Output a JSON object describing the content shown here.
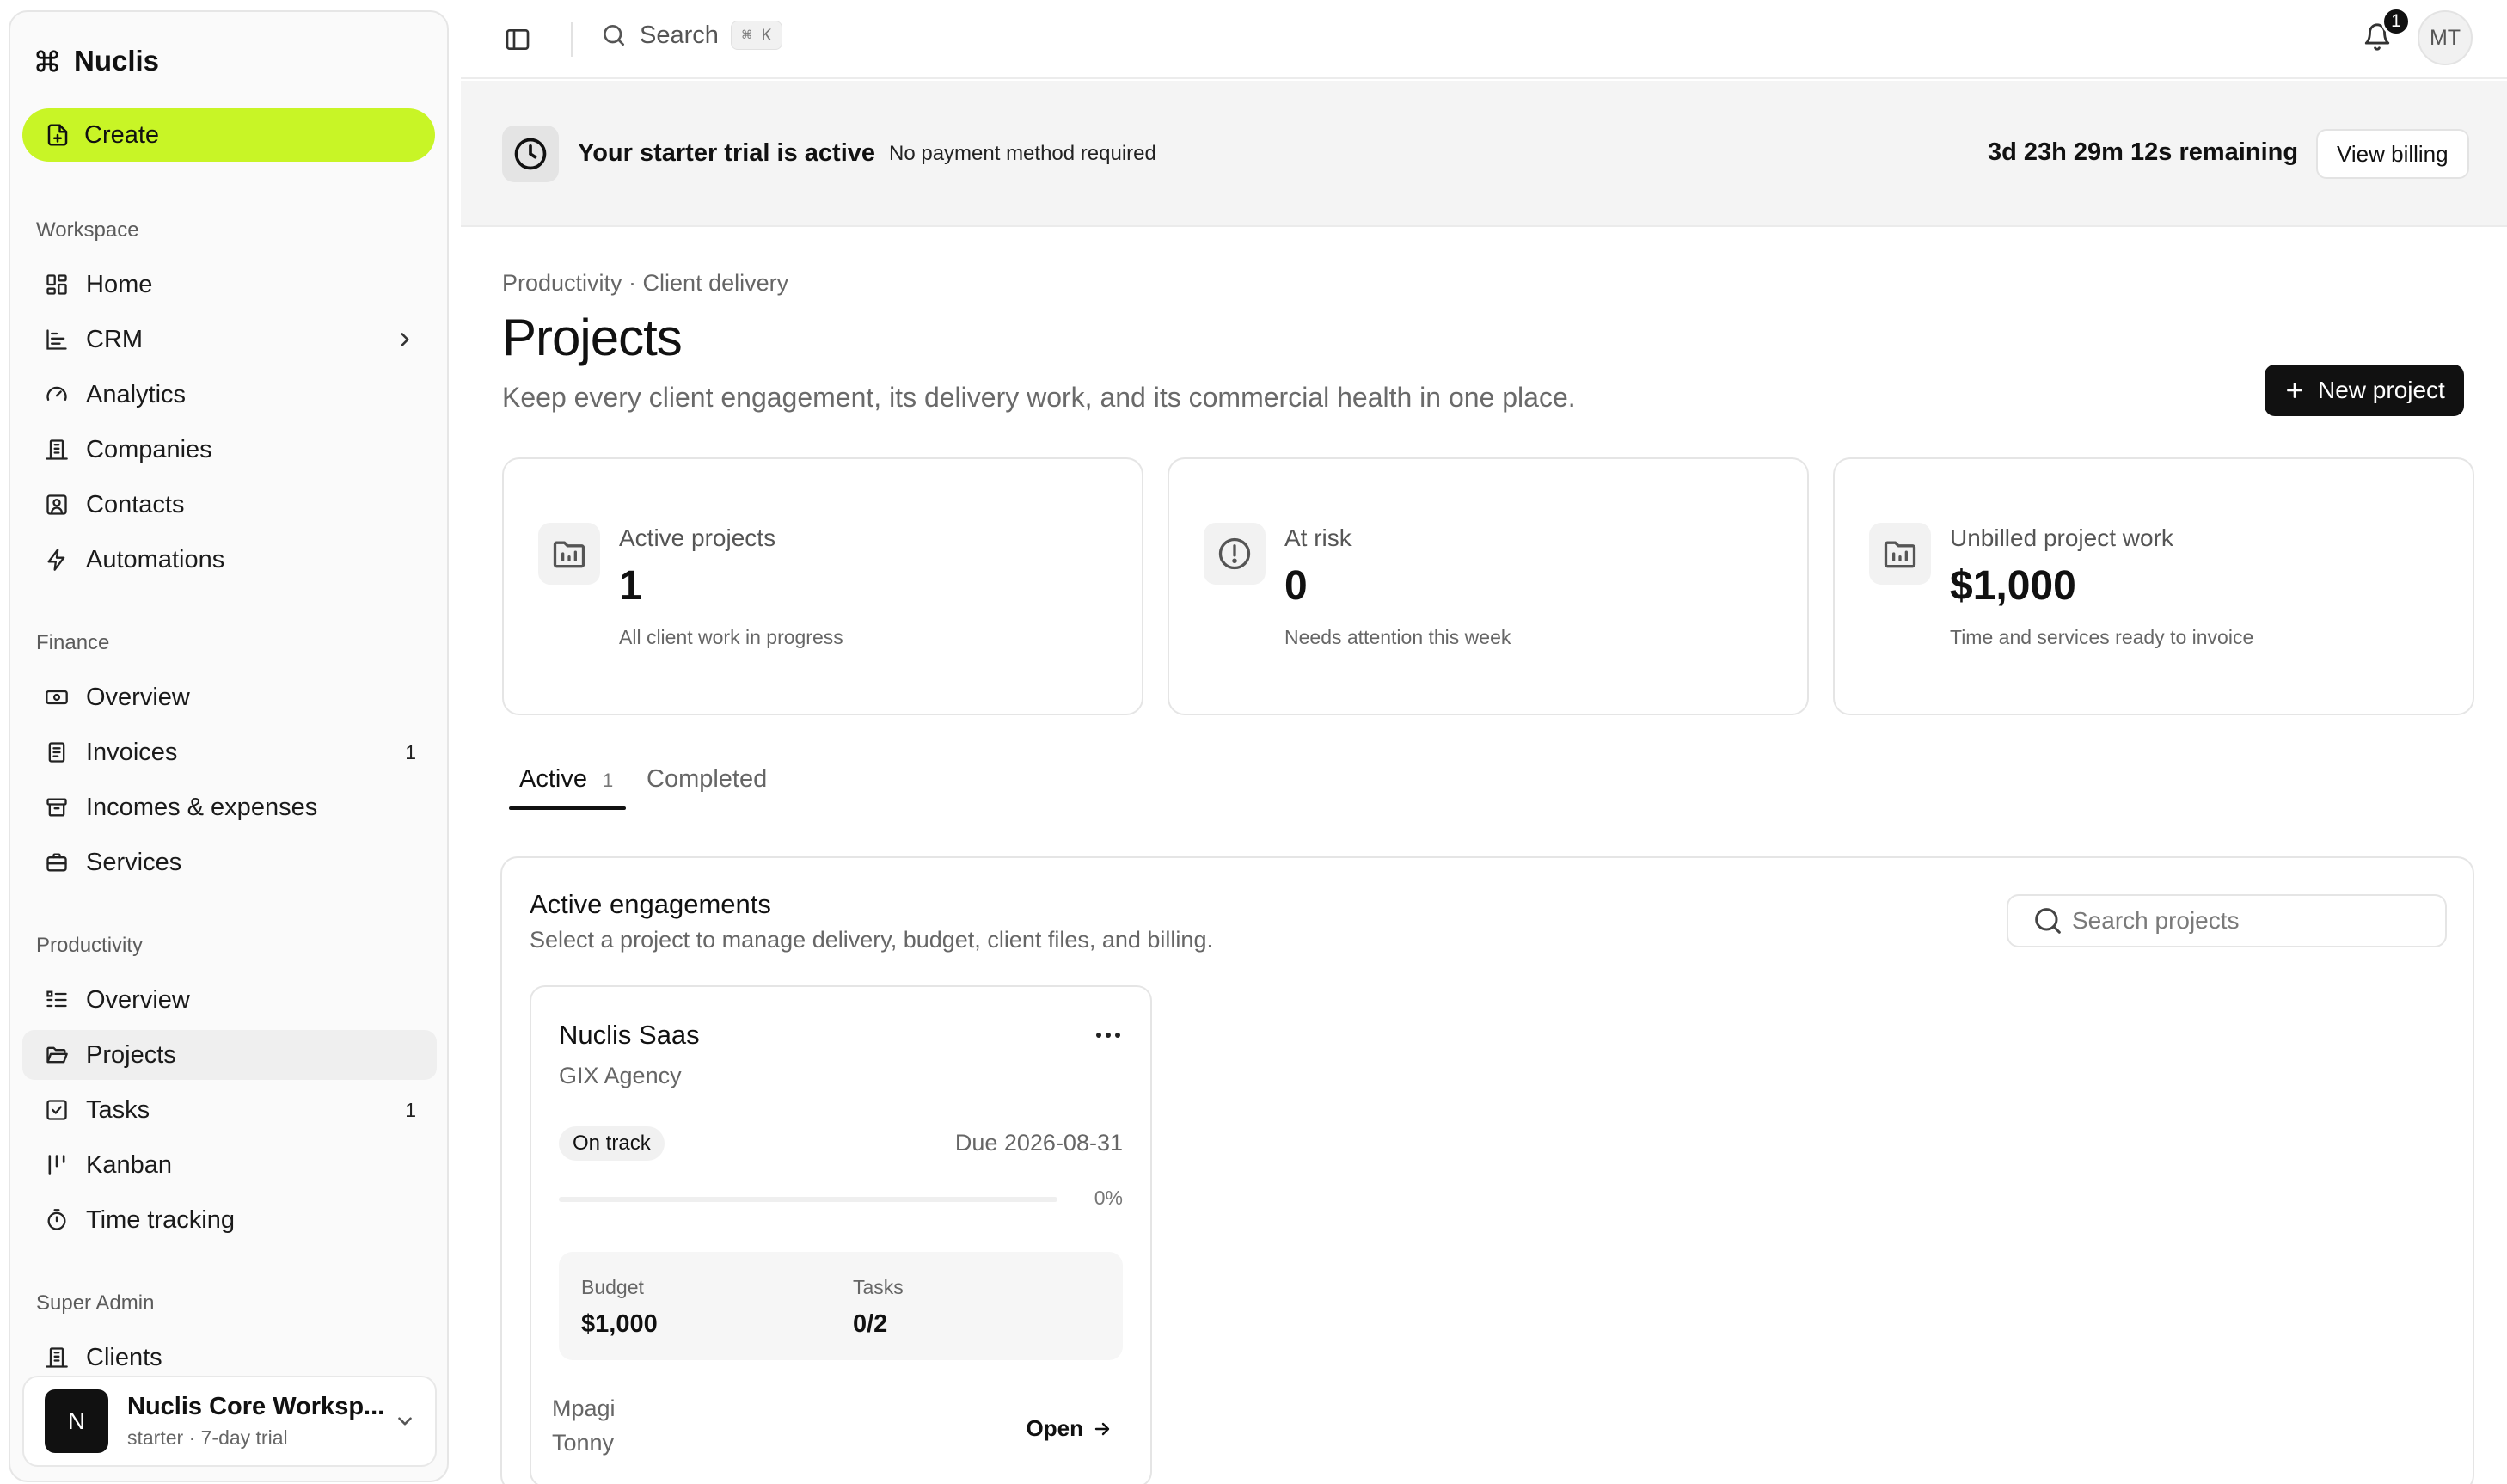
{
  "sidebar": {
    "brand": "Nuclis",
    "create_label": "Create",
    "sections": [
      {
        "label": "Workspace",
        "items": [
          {
            "label": "Home",
            "icon": "home-icon"
          },
          {
            "label": "CRM",
            "icon": "chart-icon"
          },
          {
            "label": "Analytics",
            "icon": "gauge-icon"
          },
          {
            "label": "Companies",
            "icon": "building-icon"
          },
          {
            "label": "Contacts",
            "icon": "contact-icon"
          },
          {
            "label": "Automations",
            "icon": "bolt-icon"
          }
        ]
      },
      {
        "label": "Finance",
        "items": [
          {
            "label": "Overview",
            "icon": "banknote-icon"
          },
          {
            "label": "Invoices",
            "icon": "invoice-icon",
            "count": "1"
          },
          {
            "label": "Incomes & expenses",
            "icon": "archive-icon"
          },
          {
            "label": "Services",
            "icon": "briefcase-icon"
          }
        ]
      },
      {
        "label": "Productivity",
        "items": [
          {
            "label": "Overview",
            "icon": "list-icon"
          },
          {
            "label": "Projects",
            "icon": "folder-open-icon"
          },
          {
            "label": "Tasks",
            "icon": "checkbox-icon",
            "count": "1"
          },
          {
            "label": "Kanban",
            "icon": "kanban-icon"
          },
          {
            "label": "Time tracking",
            "icon": "timer-icon"
          }
        ]
      },
      {
        "label": "Super Admin",
        "items": [
          {
            "label": "Clients",
            "icon": "building-icon"
          }
        ]
      }
    ],
    "workspace": {
      "initial": "N",
      "name": "Nuclis Core Worksp...",
      "plan": "starter · 7-day trial"
    }
  },
  "topbar": {
    "search_label": "Search",
    "search_shortcut": "⌘ K",
    "notification_count": "1",
    "user_initials": "MT"
  },
  "banner": {
    "title": "Your starter trial is active",
    "subtitle": "No payment method required",
    "remaining": "3d 23h 29m 12s remaining",
    "billing_label": "View billing"
  },
  "page": {
    "breadcrumb": "Productivity · Client delivery",
    "title": "Projects",
    "subtitle": "Keep every client engagement, its delivery work, and its commercial health in one place.",
    "new_project_label": "New project"
  },
  "stats": [
    {
      "label": "Active projects",
      "value": "1",
      "note": "All client work in progress",
      "icon": "folder-chart-icon"
    },
    {
      "label": "At risk",
      "value": "0",
      "note": "Needs attention this week",
      "icon": "alert-circle-icon"
    },
    {
      "label": "Unbilled project work",
      "value": "$1,000",
      "note": "Time and services ready to invoice",
      "icon": "folder-chart-icon"
    }
  ],
  "tabs": {
    "active_label": "Active",
    "active_count": "1",
    "completed_label": "Completed"
  },
  "engagements": {
    "title": "Active engagements",
    "subtitle": "Select a project to manage delivery, budget, client files, and billing.",
    "search_placeholder": "Search projects",
    "projects": [
      {
        "name": "Nuclis Saas",
        "client": "GIX Agency",
        "status": "On track",
        "due": "Due 2026-08-31",
        "progress_percent": 0,
        "progress_label": "0%",
        "budget_label": "Budget",
        "budget_value": "$1,000",
        "tasks_label": "Tasks",
        "tasks_value": "0/2",
        "owner": "Mpagi Tonny",
        "open_label": "Open"
      }
    ]
  }
}
